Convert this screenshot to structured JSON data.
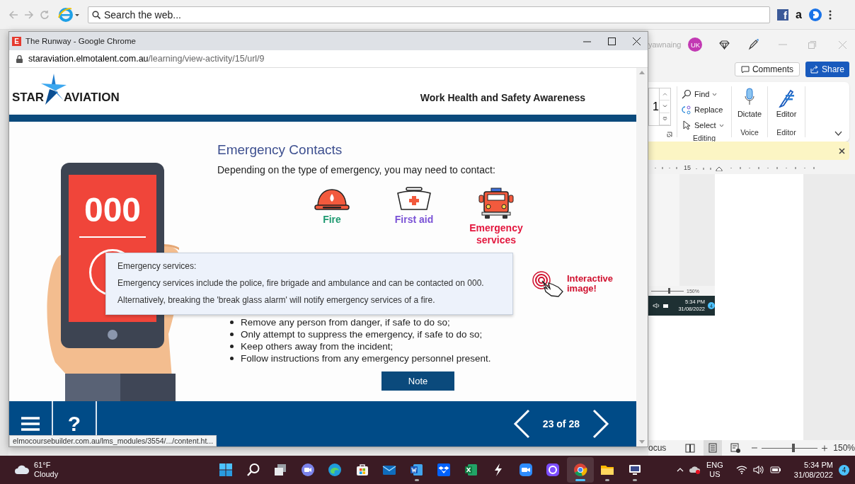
{
  "desktop_browser": {
    "search": {
      "placeholder": "Search the web..."
    },
    "extensions": [
      {
        "kind": "facebook",
        "glyph": "f"
      },
      {
        "kind": "amazon",
        "glyph": "a"
      },
      {
        "kind": "d_circle"
      }
    ]
  },
  "word": {
    "account": "yawnaing",
    "avatar": "UK",
    "buttons": [
      {
        "kind": "comments",
        "label": "Comments"
      },
      {
        "kind": "share",
        "label": "Share"
      }
    ],
    "font_size": "1",
    "groups": [
      {
        "kind": "editing",
        "label": "Editing",
        "items": [
          {
            "kind": "find",
            "label": "Find"
          },
          {
            "kind": "replace",
            "label": "Replace"
          },
          {
            "kind": "select",
            "label": "Select"
          }
        ]
      },
      {
        "kind": "voice",
        "label": "Voice",
        "items": [
          {
            "kind": "dictate",
            "label": "Dictate"
          }
        ]
      },
      {
        "kind": "editor",
        "label": "Editor",
        "items": [
          {
            "kind": "editor",
            "label": "Editor"
          }
        ]
      }
    ],
    "ruler_label": "15",
    "embedded_screenshot": {
      "zoom": {
        "level": 0.55,
        "reading": "150%"
      },
      "time": "5:34 PM",
      "date": "31/08/2022",
      "badge": "4"
    },
    "status_bar": {
      "focus": "ocus",
      "views": [
        {
          "kind": "read",
          "selected": false
        },
        {
          "kind": "print",
          "selected": true
        },
        {
          "kind": "web",
          "selected": false
        }
      ],
      "zoom": {
        "level": 0.56,
        "reading": "150%"
      }
    }
  },
  "chrome_window": {
    "favicon": "E",
    "title": "The Runway - Google Chrome",
    "url": {
      "host": "staraviation.elmotalent.com.au",
      "path": "/learning/view-activity/15/url/9"
    },
    "page": {
      "logo": [
        "STAR",
        "AVIATION"
      ],
      "course_title": "Work Health and Safety Awareness",
      "phone_screen": "000",
      "heading": "Emergency Contacts",
      "intro": "Depending on the type of emergency, you may need to contact:",
      "contacts": [
        {
          "kind": "fire",
          "label": "Fire",
          "color": "#1e9970"
        },
        {
          "kind": "first_aid",
          "label": "First aid",
          "color": "#7a52d6"
        },
        {
          "kind": "emergency",
          "label": "Emergency services",
          "color": "#e3173e"
        }
      ],
      "tooltip": {
        "title": "Emergency services:",
        "lines": [
          "Emergency services include the police, fire brigade and ambulance and can be contacted on 000.",
          "Alternatively, breaking the 'break glass alarm' will notify emergency services of a fire."
        ]
      },
      "interactive_hint": "Interactive image!",
      "bullets": [
        "Remove any person from danger, if safe to do so;",
        "Only attempt to suppress the emergency, if safe to do so;",
        "Keep others away from the incident;",
        "Follow instructions from any emergency personnel present."
      ],
      "note_button": "Note",
      "footer": {
        "help": "?",
        "progress": "23 of 28"
      }
    },
    "status_link": "elmocoursebuilder.com.au/lms_modules/3554/.../content.ht..."
  },
  "taskbar": {
    "weather": {
      "temperature": "61°F",
      "condition": "Cloudy"
    },
    "apps": [
      {
        "kind": "start",
        "running": false,
        "selected": false
      },
      {
        "kind": "search",
        "running": false,
        "selected": false
      },
      {
        "kind": "taskview",
        "running": false,
        "selected": false
      },
      {
        "kind": "chat",
        "running": false,
        "selected": false
      },
      {
        "kind": "edge",
        "running": false,
        "selected": false
      },
      {
        "kind": "store",
        "running": false,
        "selected": false
      },
      {
        "kind": "mail",
        "running": false,
        "selected": false
      },
      {
        "kind": "word",
        "running": true,
        "selected": false
      },
      {
        "kind": "dropbox",
        "running": false,
        "selected": false
      },
      {
        "kind": "excel",
        "running": false,
        "selected": false
      },
      {
        "kind": "bolt",
        "running": false,
        "selected": false
      },
      {
        "kind": "zoom",
        "running": false,
        "selected": false
      },
      {
        "kind": "ring",
        "running": false,
        "selected": false
      },
      {
        "kind": "chrome",
        "running": true,
        "selected": true
      },
      {
        "kind": "explorer",
        "running": true,
        "selected": false
      },
      {
        "kind": "remote",
        "running": true,
        "selected": false
      }
    ],
    "tray": {
      "language": [
        "ENG",
        "US"
      ],
      "time": "5:34 PM",
      "date": "31/08/2022",
      "badge": "4"
    }
  }
}
